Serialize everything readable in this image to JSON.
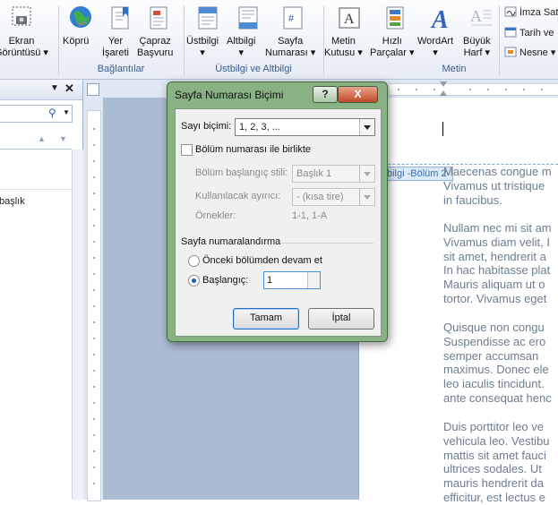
{
  "ribbon": {
    "buttons": [
      {
        "label": "Ekran\nGörüntüsü ▾"
      },
      {
        "label": "Köprü"
      },
      {
        "label": "Yer\nİşareti"
      },
      {
        "label": "Çapraz\nBaşvuru"
      },
      {
        "label": "Üstbilgi\n▾"
      },
      {
        "label": "Altbilgi\n▾"
      },
      {
        "label": "Sayfa\nNumarası ▾"
      },
      {
        "label": "Metin\nKutusu ▾"
      },
      {
        "label": "Hızlı\nParçalar ▾"
      },
      {
        "label": "WordArt\n▾"
      },
      {
        "label": "Büyük\nHarf ▾"
      }
    ],
    "groups": {
      "links": "Bağlantılar",
      "header_footer": "Üstbilgi ve Altbilgi",
      "text": "Metin"
    },
    "small_commands": [
      "İmza Sat",
      "Tarih ve",
      "Nesne ▾"
    ]
  },
  "nav_pane": {
    "item": "başlık"
  },
  "document": {
    "header_tag": "bilgi -Bölüm 2-",
    "paragraphs": [
      [
        "Maecenas congue m",
        "Vivamus ut tristique",
        "in faucibus."
      ],
      [
        "Nullam nec mi sit am",
        "Vivamus diam velit, I",
        "sit amet, hendrerit a",
        "In hac habitasse plat",
        "Mauris aliquam ut o",
        "tortor. Vivamus eget"
      ],
      [
        "Quisque non congu",
        "Suspendisse ac ero",
        "semper accumsan",
        "maximus. Donec ele",
        "leo iaculis tincidunt.",
        "ante consequat henc"
      ],
      [
        "Duis porttitor leo ve",
        "vehicula leo. Vestibu",
        "mattis sit amet fauci",
        "ultrices sodales. Ut",
        "mauris hendrerit da",
        "efficitur, est lectus e"
      ]
    ]
  },
  "dialog": {
    "title": "Sayfa Numarası Biçimi",
    "help": "?",
    "close": "X",
    "format_label": "Sayı biçimi:",
    "format_value": "1, 2, 3, ...",
    "include_chapter": "Bölüm numarası ile birlikte",
    "chapter_style_label": "Bölüm başlangıç stili:",
    "chapter_style_value": "Başlık 1",
    "separator_label": "Kullanılacak ayırıcı:",
    "separator_value": "-   (kısa tire)",
    "examples_label": "Örnekler:",
    "examples_value": "1-1, 1-A",
    "numbering_section": "Sayfa numaralandırma",
    "continue_option": "Önceki bölümden devam et",
    "start_option": "Başlangıç:",
    "start_value": "1",
    "ok": "Tamam",
    "cancel": "İptal"
  }
}
